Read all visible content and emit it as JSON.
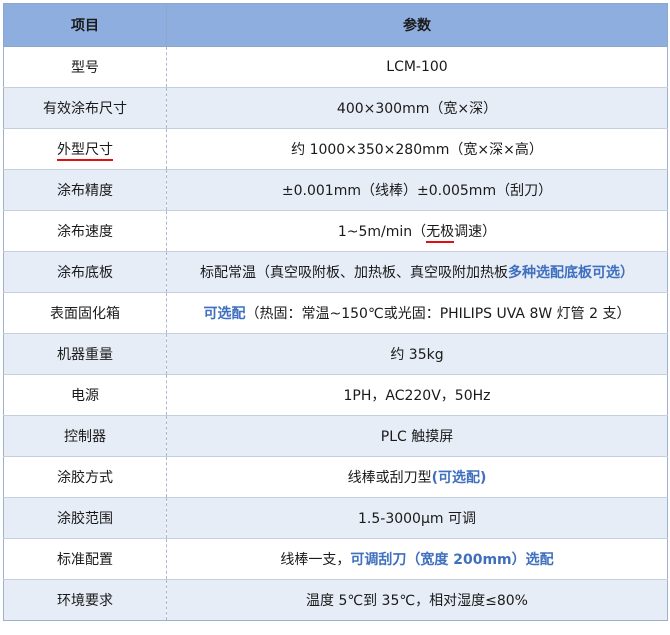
{
  "header": {
    "col1": "项目",
    "col2": "参数"
  },
  "rows": [
    {
      "label": "型号",
      "value": "LCM-100"
    },
    {
      "label": "有效涂布尺寸",
      "value": "400×300mm（宽×深）"
    },
    {
      "label": "外型尺寸",
      "value": "约 1000×350×280mm（宽×深×高）"
    },
    {
      "label": "涂布精度",
      "value": "±0.001mm（线棒）±0.005mm（刮刀）"
    },
    {
      "label": "涂布速度",
      "value_pre": "1~5m/min（",
      "value_ul": "无极",
      "value_post": "调速）"
    },
    {
      "label": "涂布底板",
      "value_pre": "标配常温（真空吸附板、加热板、真空吸附加热板",
      "value_blue": "多种选配底板可选）"
    },
    {
      "label": "表面固化箱",
      "value_blue": "可选配",
      "value_post": "（热固：常温~150℃或光固：PHILIPS UVA 8W 灯管 2 支）"
    },
    {
      "label": "机器重量",
      "value": "约 35kg"
    },
    {
      "label": "电源",
      "value": "1PH，AC220V，50Hz"
    },
    {
      "label": "控制器",
      "value": "PLC 触摸屏"
    },
    {
      "label": "涂胶方式",
      "value_pre": "线棒或刮刀型",
      "value_blue": "(可选配)"
    },
    {
      "label": "涂胶范围",
      "value": "1.5-3000μm 可调"
    },
    {
      "label": "标准配置",
      "value_pre": "线棒一支，",
      "value_blue": "可调刮刀（宽度 200mm）选配"
    },
    {
      "label": "环境要求",
      "value": "温度 5℃到 35℃，相对湿度≤80%"
    }
  ],
  "colors": {
    "header_bg": "#8eaee0",
    "stripe_bg": "#e7edf6",
    "accent_blue": "#3f6fbf",
    "underline_red": "#e01010"
  }
}
